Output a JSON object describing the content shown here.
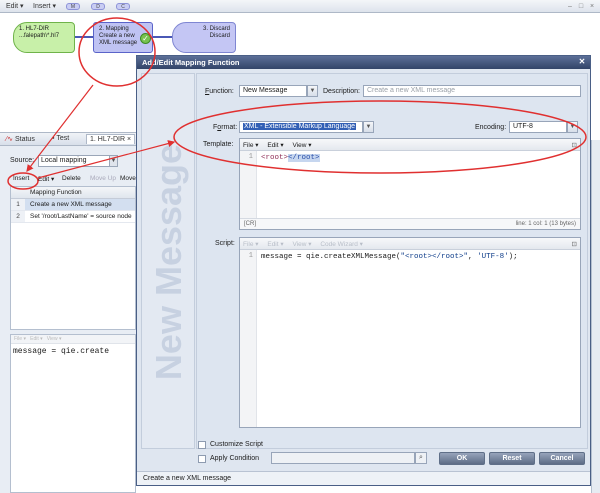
{
  "toolbar": {
    "edit": "Edit ▾",
    "insert": "Insert ▾",
    "chips": [
      "M",
      "D",
      "C"
    ]
  },
  "flow": {
    "node1": {
      "title": "1. HL7-DIR",
      "subtitle": "...falepath\\*.hl7"
    },
    "node2": {
      "title": "2. Mapping",
      "line1": "Create a new",
      "line2": "XML message"
    },
    "node3": {
      "title": "3. Discard",
      "subtitle": "Discard"
    }
  },
  "tabs": [
    "Status",
    "Test",
    "1. HL7-DIR"
  ],
  "left_panel": {
    "source_label": "Source:",
    "source_value": "Local mapping",
    "toolbar": [
      "Insert",
      "Edit ▾",
      "Delete",
      "Move Up",
      "Move"
    ],
    "column_header": "Mapping Function",
    "rows": [
      {
        "num": "1",
        "text": "Create a new XML message"
      },
      {
        "num": "2",
        "text": "Set '/root/LastName' = source node"
      }
    ],
    "script_code": "message = qie.create"
  },
  "dialog": {
    "title": "Add/Edit Mapping Function",
    "side_label": "New Message",
    "function_label": "Function:",
    "function_value": "New Message",
    "description_label": "Description:",
    "description_placeholder": "Create a new XML message",
    "format_label": "Format:",
    "format_value": "XML - Extensible Markup Language",
    "encoding_label": "Encoding:",
    "encoding_value": "UTF-8",
    "template_label": "Template:",
    "template_menu": [
      "File ▾",
      "Edit ▾",
      "View ▾"
    ],
    "template_code": {
      "open": "<root>",
      "close": "</root>"
    },
    "template_mode": "[CR]",
    "template_position": "line: 1  col: 1  (13 bytes)",
    "script_label": "Script:",
    "script_menu": [
      "File ▾",
      "Edit ▾",
      "View ▾",
      "Code Wizard ▾"
    ],
    "script_code": {
      "lhs": "message = qie.createXMLMessage(",
      "arg1": "\"<root></root>\"",
      "sep": ", ",
      "arg2": "'UTF-8'",
      "end": ");"
    },
    "customize_script": "Customize Script",
    "apply_condition": "Apply Condition",
    "ok": "OK",
    "reset": "Reset",
    "cancel": "Cancel",
    "status": "Create a new XML message"
  },
  "colors": {
    "annotation": "#e03030",
    "title_bar": "#3b4d73",
    "selection": "#3360b5"
  },
  "icons": [
    "dropdown-arrow-icon",
    "close-icon",
    "search-icon",
    "check-icon",
    "expand-icon"
  ]
}
